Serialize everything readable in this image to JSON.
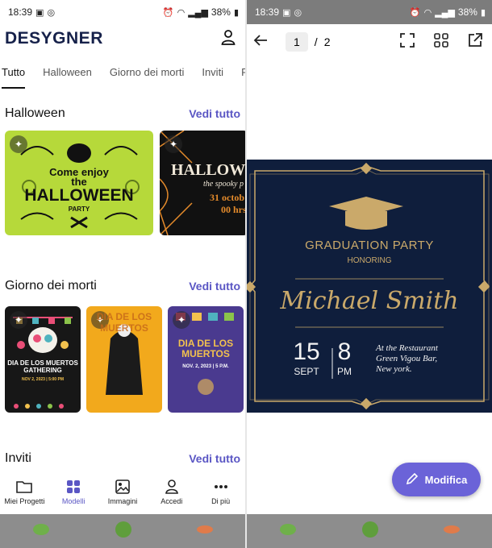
{
  "status": {
    "time": "18:39",
    "battery": "38%"
  },
  "left": {
    "logo": "DESYGNER",
    "tabs": [
      "Tutto",
      "Halloween",
      "Giorno dei morti",
      "Inviti",
      "Ri"
    ],
    "sections": [
      {
        "title": "Halloween",
        "see_all": "Vedi tutto"
      },
      {
        "title": "Giorno dei morti",
        "see_all": "Vedi tutto"
      },
      {
        "title": "Inviti",
        "see_all": "Vedi tutto"
      }
    ],
    "halloween_card1": {
      "line1": "Come enjoy",
      "line2": "the",
      "line3": "HALLOWEEN",
      "line4": "PARTY"
    },
    "halloween_card2": {
      "line1": "HALLOW",
      "line2": "the spooky p",
      "line3": "31 octob",
      "line4": "00 hrs"
    },
    "dead_card1": {
      "title": "DIA DE LOS MUERTOS",
      "sub": "GATHERING",
      "date": "NOV 2, 2023 | 5:00 PM"
    },
    "dead_card2": {
      "line1": "DIA DE LOS",
      "line2": "MUERTOS"
    },
    "dead_card3": {
      "line1": "DIA DE LOS",
      "line2": "MUERTOS",
      "date": "NOV. 2, 2023 | 5 P.M."
    },
    "nav": [
      {
        "label": "Miei Progetti",
        "icon": "folder-icon"
      },
      {
        "label": "Modelli",
        "icon": "grid-icon"
      },
      {
        "label": "Immagini",
        "icon": "image-icon"
      },
      {
        "label": "Accedi",
        "icon": "user-icon"
      },
      {
        "label": "Di più",
        "icon": "more-icon"
      }
    ]
  },
  "right": {
    "page_current": "1",
    "page_sep": "/",
    "page_total": "2",
    "invite": {
      "title": "GRADUATION PARTY",
      "honoring": "HONORING",
      "name": "Michael Smith",
      "day": "15",
      "month": "SEPT",
      "hour": "8",
      "ampm": "PM",
      "loc1": "At the Restaurant",
      "loc2": "Green Vigou Bar,",
      "loc3": "New york."
    },
    "fab_label": "Modifica"
  },
  "colors": {
    "accent": "#5a56c4",
    "brand": "#16214a",
    "invite_bg": "#0f1e3c",
    "gold": "#caa96a",
    "lime": "#b6d93a"
  }
}
